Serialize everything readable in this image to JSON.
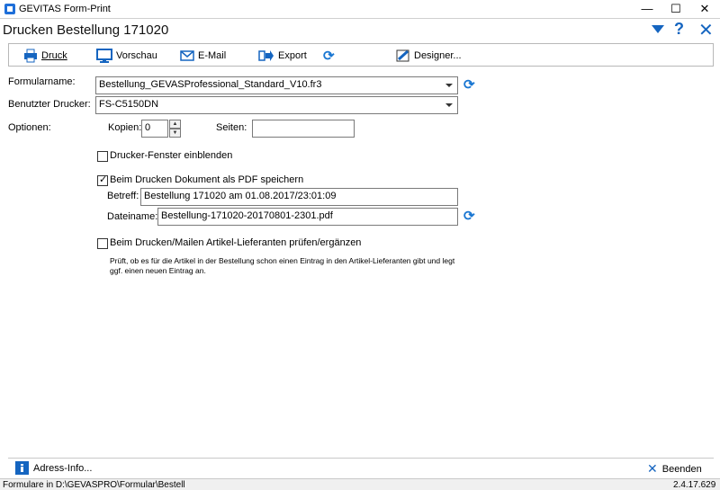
{
  "window": {
    "app_title": "GEVITAS Form-Print",
    "minimize": "—",
    "maximize": "☐",
    "close": "✕"
  },
  "header": {
    "title": "Drucken  Bestellung 171020",
    "help": "?",
    "close": "✕"
  },
  "toolbar": {
    "print_label": "Druck",
    "preview_label": "Vorschau",
    "email_label": "E-Mail",
    "export_label": "Export",
    "designer_label": "Designer..."
  },
  "form": {
    "formularname_label": "Formularname:",
    "formularname_value": "Bestellung_GEVASProfessional_Standard_V10.fr3",
    "printer_label": "Benutzter Drucker:",
    "printer_value": "FS-C5150DN",
    "options_label": "Optionen:",
    "copies_label": "Kopien:",
    "copies_value": "0",
    "pages_label": "Seiten:",
    "pages_value": "",
    "show_printer_window_label": "Drucker-Fenster einblenden",
    "show_printer_window_checked": false,
    "save_pdf_label": "Beim Drucken Dokument als PDF speichern",
    "save_pdf_checked": true,
    "subject_label": "Betreff:",
    "subject_value": "Bestellung 171020 am 01.08.2017/23:01:09",
    "filename_label": "Dateiname:",
    "filename_value": "Bestellung-171020-20170801-2301.pdf",
    "check_suppliers_label": "Beim Drucken/Mailen Artikel-Lieferanten prüfen/ergänzen",
    "check_suppliers_checked": false,
    "check_suppliers_help_1": "Prüft, ob es für die Artikel in der Bestellung schon einen Eintrag in den Artikel-Lieferanten gibt und legt",
    "check_suppliers_help_2": "ggf. einen neuen Eintrag an."
  },
  "bottom": {
    "address_info_label": "Adress-Info...",
    "quit_label": "Beenden"
  },
  "status": {
    "path": "Formulare in D:\\GEVASPRO\\Formular\\Bestell",
    "version": "2.4.17.629"
  },
  "colors": {
    "accent": "#1565c0",
    "refresh": "#1976d2"
  }
}
